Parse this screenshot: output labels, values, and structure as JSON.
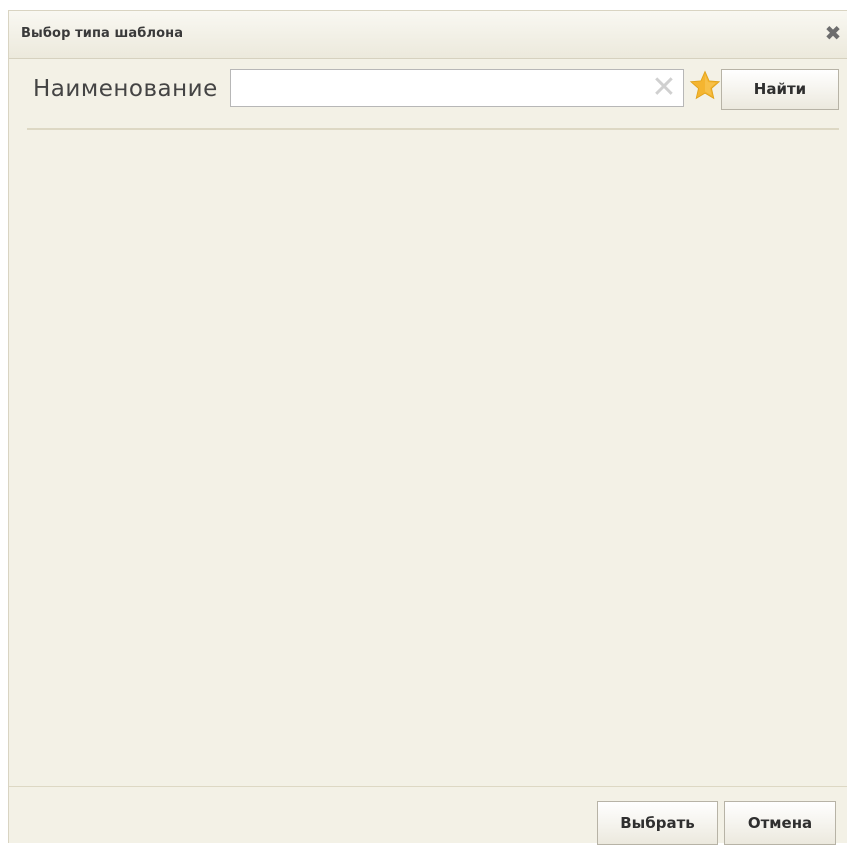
{
  "dialog": {
    "title": "Выбор типа шаблона",
    "close_symbol": "✖",
    "close_icon": "close-icon"
  },
  "search": {
    "label": "Наименование",
    "value": "",
    "placeholder": "",
    "clear_symbol": "✕",
    "clear_icon": "clear-icon",
    "favorite_icon": "star-icon",
    "favorite_color": "#f2b632",
    "find_label": "Найти"
  },
  "footer": {
    "select_label": "Выбрать",
    "cancel_label": "Отмена"
  }
}
